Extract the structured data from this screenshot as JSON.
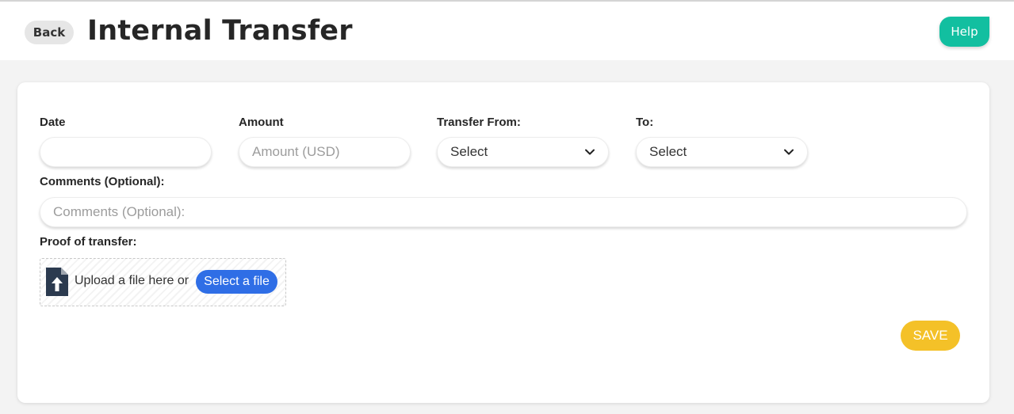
{
  "header": {
    "back_label": "Back",
    "title": "Internal Transfer",
    "help_label": "Help"
  },
  "form": {
    "date": {
      "label": "Date",
      "value": "",
      "placeholder": ""
    },
    "amount": {
      "label": "Amount",
      "value": "",
      "placeholder": "Amount (USD)"
    },
    "transfer_from": {
      "label": "Transfer From:",
      "selected": "Select"
    },
    "to": {
      "label": "To:",
      "selected": "Select"
    },
    "comments": {
      "label": "Comments (Optional):",
      "value": "",
      "placeholder": "Comments (Optional):"
    },
    "proof": {
      "label": "Proof of transfer:",
      "upload_text": "Upload a file here or",
      "select_file_label": "Select a file",
      "icon": "file-upload-icon"
    },
    "save_label": "SAVE"
  },
  "colors": {
    "help": "#12bfa0",
    "select_file": "#2f6ee6",
    "save": "#f4c128"
  }
}
